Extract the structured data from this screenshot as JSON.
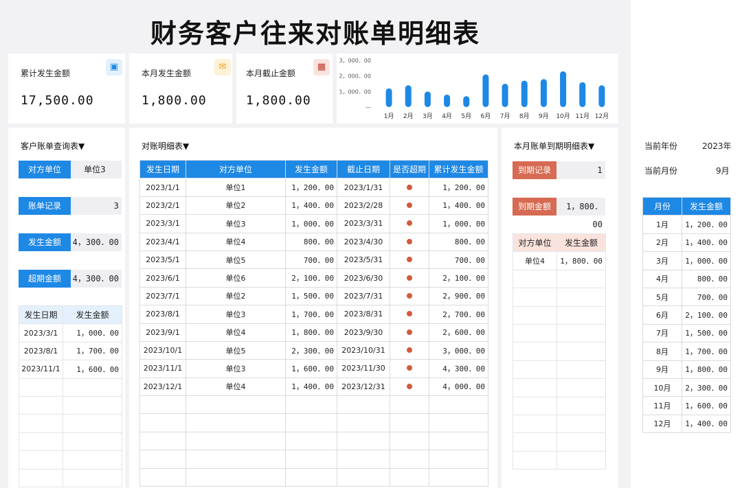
{
  "title": "财务客户往来对账单明细表",
  "colors": {
    "accent": "#1e88e5",
    "overdue": "#d35a3a",
    "pink": "#fbe3dd"
  },
  "cards": [
    {
      "label": "累计发生金额",
      "value": "17,500.00",
      "icon": "wallet-icon"
    },
    {
      "label": "本月发生金额",
      "value": "1,800.00",
      "icon": "ticket-icon"
    },
    {
      "label": "本月截止金额",
      "value": "1,800.00",
      "icon": "calculator-icon"
    }
  ],
  "chart_data": {
    "type": "bar",
    "categories": [
      "1月",
      "2月",
      "3月",
      "4月",
      "5月",
      "6月",
      "7月",
      "8月",
      "9月",
      "10月",
      "11月",
      "12月"
    ],
    "values": [
      1200,
      1400,
      1000,
      800,
      700,
      2100,
      1500,
      1700,
      1800,
      2300,
      1600,
      1400
    ],
    "ylim": [
      0,
      3000
    ],
    "yticks": [
      "3，000．00",
      "2，000．00",
      "1，000．00",
      "—"
    ]
  },
  "query": {
    "title": "客户账单查询表▼",
    "party_label": "对方单位",
    "party_value": "单位3",
    "records_label": "账单记录",
    "records_value": "3",
    "amount_label": "发生金额",
    "amount_value": "4，300．00",
    "overdue_label": "超期金额",
    "overdue_value": "4，300．00",
    "headers": [
      "发生日期",
      "发生金额"
    ],
    "rows": [
      [
        "2023/3/1",
        "1，000．00"
      ],
      [
        "2023/8/1",
        "1，700．00"
      ],
      [
        "2023/11/1",
        "1，600．00"
      ]
    ]
  },
  "detail": {
    "title": "对账明细表▼",
    "headers": [
      "发生日期",
      "对方单位",
      "发生金额",
      "截止日期",
      "是否超期",
      "累计发生金额"
    ],
    "rows": [
      [
        "2023/1/1",
        "单位1",
        "1，200．00",
        "2023/1/31",
        "1，200．00"
      ],
      [
        "2023/2/1",
        "单位2",
        "1，400．00",
        "2023/2/28",
        "1，400．00"
      ],
      [
        "2023/3/1",
        "单位3",
        "1，000．00",
        "2023/3/31",
        "1，000．00"
      ],
      [
        "2023/4/1",
        "单位4",
        "800．00",
        "2023/4/30",
        "800．00"
      ],
      [
        "2023/5/1",
        "单位5",
        "700．00",
        "2023/5/31",
        "700．00"
      ],
      [
        "2023/6/1",
        "单位6",
        "2，100．00",
        "2023/6/30",
        "2，100．00"
      ],
      [
        "2023/7/1",
        "单位2",
        "1，500．00",
        "2023/7/31",
        "2，900．00"
      ],
      [
        "2023/8/1",
        "单位3",
        "1，700．00",
        "2023/8/31",
        "2，700．00"
      ],
      [
        "2023/9/1",
        "单位4",
        "1，800．00",
        "2023/9/30",
        "2，600．00"
      ],
      [
        "2023/10/1",
        "单位5",
        "2，300．00",
        "2023/10/31",
        "3，000．00"
      ],
      [
        "2023/11/1",
        "单位3",
        "1，600．00",
        "2023/11/30",
        "4，300．00"
      ],
      [
        "2023/12/1",
        "单位4",
        "1，400．00",
        "2023/12/31",
        "4，000．00"
      ]
    ]
  },
  "due": {
    "title": "本月账单到期明细表▼",
    "records_label": "到期记录",
    "records_value": "1",
    "amount_label": "到期金额",
    "amount_value": "1，800．00",
    "headers": [
      "对方单位",
      "发生金额"
    ],
    "rows": [
      [
        "单位4",
        "1，800．00"
      ]
    ]
  },
  "side": {
    "year_label": "当前年份",
    "year_value": "2023年",
    "month_label": "当前月份",
    "month_value": "9月",
    "headers": [
      "月份",
      "发生金额"
    ],
    "rows": [
      [
        "1月",
        "1，200．00"
      ],
      [
        "2月",
        "1，400．00"
      ],
      [
        "3月",
        "1，000．00"
      ],
      [
        "4月",
        "800．00"
      ],
      [
        "5月",
        "700．00"
      ],
      [
        "6月",
        "2，100．00"
      ],
      [
        "7月",
        "1，500．00"
      ],
      [
        "8月",
        "1，700．00"
      ],
      [
        "9月",
        "1，800．00"
      ],
      [
        "10月",
        "2，300．00"
      ],
      [
        "11月",
        "1，600．00"
      ],
      [
        "12月",
        "1，400．00"
      ]
    ]
  }
}
